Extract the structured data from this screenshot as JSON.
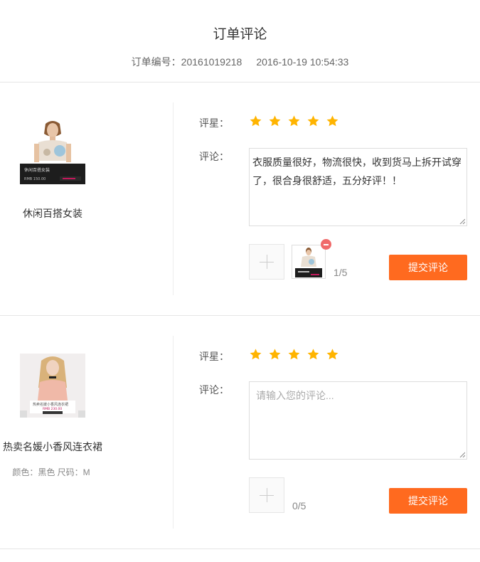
{
  "page": {
    "title": "订单评论",
    "order_number_label": "订单编号：",
    "order_number": "20161019218",
    "order_time": "2016-10-19 10:54:33"
  },
  "labels": {
    "rating": "评星：",
    "comment": "评论：",
    "submit": "提交评论"
  },
  "items": [
    {
      "name": "休闲百搭女装",
      "thumb_text_1": "休闲百搭女装",
      "thumb_text_2": "RMB 150.00",
      "rating": 5,
      "comment": "衣服质量很好，物流很快，收到货马上拆开试穿了，很合身很舒适，五分好评！！",
      "upload_count": "1/5"
    },
    {
      "name": "热卖名媛小香风连衣裙",
      "attrs": "颜色：黑色 尺码：M",
      "thumb_text_1": "热卖名媛小香风连衣裙",
      "thumb_text_2": "RMB 230.00",
      "rating": 5,
      "comment_placeholder": "请输入您的评论...",
      "upload_count": "0/5"
    }
  ],
  "colors": {
    "accent": "#ff6a1f",
    "star": "#ffb400",
    "remove": "#f06a6a"
  },
  "icons": {
    "star": "star-icon",
    "add": "plus-icon",
    "remove": "minus-circle-icon"
  }
}
